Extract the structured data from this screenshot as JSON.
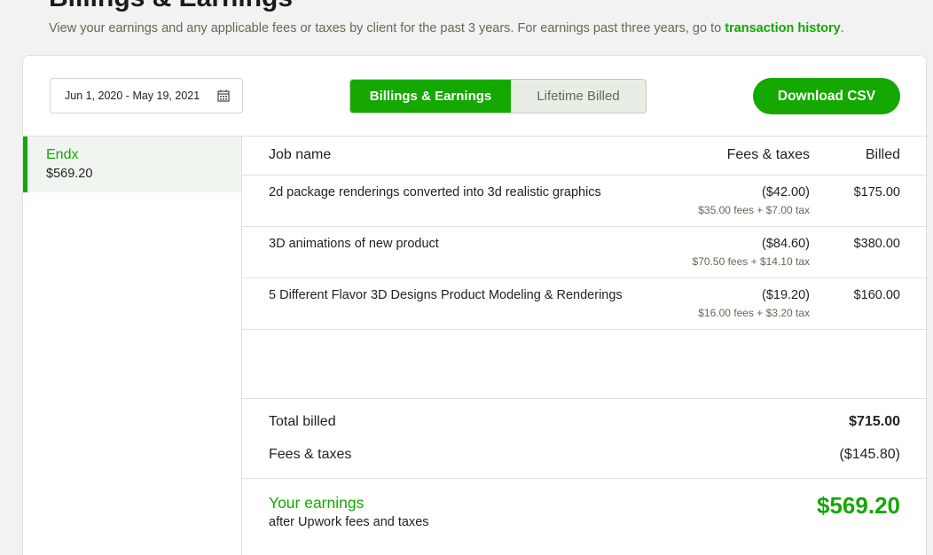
{
  "header": {
    "title": "Billings & Earnings",
    "intro_text": "View your earnings and any applicable fees or taxes by client for the past 3 years. For earnings past three years, go to ",
    "intro_link": "transaction history",
    "intro_end": "."
  },
  "toolbar": {
    "date_range": "Jun 1, 2020 - May 19, 2021",
    "toggle_active": "Billings & Earnings",
    "toggle_inactive": "Lifetime Billed",
    "download_label": "Download CSV"
  },
  "sidebar": {
    "clients": [
      {
        "name": "Endx",
        "amount": "$569.20"
      }
    ]
  },
  "table": {
    "headers": {
      "job": "Job name",
      "fees": "Fees & taxes",
      "billed": "Billed"
    },
    "rows": [
      {
        "job": "2d package renderings converted into 3d realistic graphics",
        "fees": "($42.00)",
        "breakdown": "$35.00 fees + $7.00 tax",
        "billed": "$175.00"
      },
      {
        "job": "3D animations of new product",
        "fees": "($84.60)",
        "breakdown": "$70.50 fees + $14.10 tax",
        "billed": "$380.00"
      },
      {
        "job": "5 Different Flavor 3D Designs Product Modeling & Renderings",
        "fees": "($19.20)",
        "breakdown": "$16.00 fees + $3.20 tax",
        "billed": "$160.00"
      }
    ]
  },
  "totals": {
    "total_billed_label": "Total billed",
    "total_billed": "$715.00",
    "fees_label": "Fees & taxes",
    "fees": "($145.80)"
  },
  "earnings": {
    "label": "Your earnings",
    "sublabel": "after Upwork fees and taxes",
    "value": "$569.20"
  },
  "colors": {
    "accent": "#14a800",
    "muted_text": "#5e6d55"
  }
}
